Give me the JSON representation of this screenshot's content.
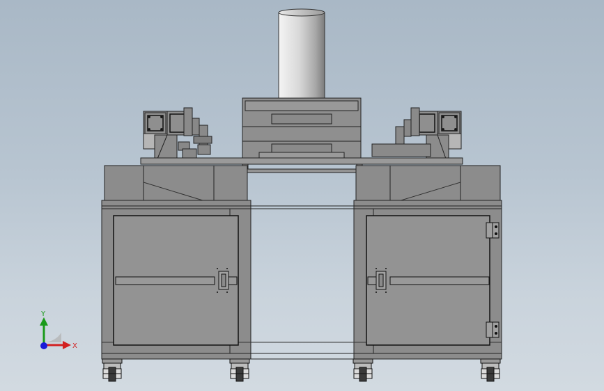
{
  "window": {
    "kind": "cad-viewport",
    "background": "#b8c5d1"
  },
  "triad": {
    "x_label": "X",
    "y_label": "Y",
    "x_color": "#d22020",
    "y_color": "#1a9a1a",
    "z_color": "#1a1ad8"
  },
  "model": {
    "line_color": "#1a1a1a",
    "body_fill": "#8c8c8c",
    "panel_fill": "#959595",
    "cylinder_light": "#f2f2f2",
    "cylinder_dark": "#8a8a8a"
  }
}
